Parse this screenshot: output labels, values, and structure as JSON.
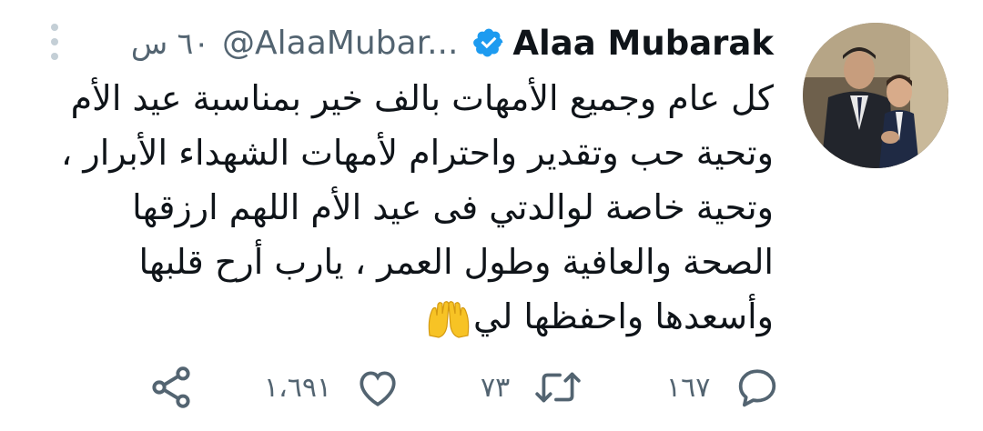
{
  "tweet": {
    "author_name": "Alaa Mubarak",
    "handle": "@AlaaMubar...",
    "time": "٦٠ س",
    "lines": [
      "كل عام وجميع الأمهات بالف خير بمناسبة عيد الأم",
      "وتحية حب وتقدير واحترام لأمهات الشهداء الأبرار ،",
      "وتحية خاصة لوالدتي فى عيد الأم اللهم ارزقها",
      "الصحة والعافية وطول العمر ، يارب أرح قلبها",
      "وأسعدها واحفظها لي"
    ],
    "emoji": "🤲",
    "verified": true
  },
  "actions": {
    "replies": "١٦٧",
    "retweets": "٧٣",
    "likes": "١،٦٩١"
  },
  "colors": {
    "verified_blue": "#1d9bf0",
    "secondary_text": "#536471",
    "primary_text": "#0f1419",
    "emoji_yellow": "#f7c325"
  },
  "icons": [
    "more-vertical-icon",
    "verified-badge-icon",
    "reply-icon",
    "retweet-icon",
    "like-icon",
    "share-icon",
    "raising-hands-emoji"
  ]
}
